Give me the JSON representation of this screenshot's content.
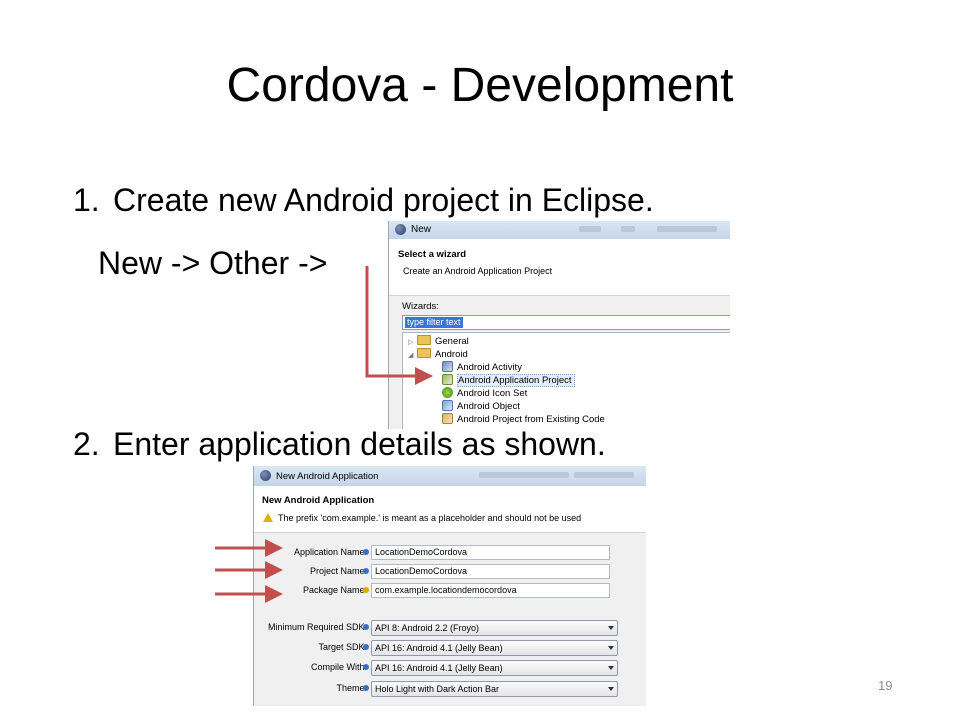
{
  "slide": {
    "title": "Cordova - Development",
    "step1_number": "1.",
    "step1_text": "Create new Android project in Eclipse.",
    "path_text": "New -> Other ->",
    "step2_number": "2.",
    "step2_text": "Enter application details as shown.",
    "slide_number": "19"
  },
  "wizard_dialog": {
    "title": "New",
    "header_title": "Select a wizard",
    "header_subtitle": "Create an Android Application Project",
    "wizards_label": "Wizards:",
    "filter_text": "type filter text",
    "tree": [
      {
        "label": "General",
        "icon": "folder-icon",
        "expanded": false
      },
      {
        "label": "Android",
        "icon": "folder-icon",
        "expanded": true
      },
      {
        "label": "Android Activity",
        "icon": "android-activity-icon"
      },
      {
        "label": "Android Application Project",
        "icon": "android-project-icon",
        "selected": true
      },
      {
        "label": "Android Icon Set",
        "icon": "android-icon-set-icon"
      },
      {
        "label": "Android Object",
        "icon": "android-object-icon"
      },
      {
        "label": "Android Project from Existing Code",
        "icon": "android-existing-code-icon"
      }
    ]
  },
  "app_dialog": {
    "title": "New Android Application",
    "header_title": "New Android Application",
    "warning_text": "The prefix 'com.example.' is meant as a placeholder and should not be used",
    "fields": [
      {
        "label": "Application Name:",
        "value": "LocationDemoCordova"
      },
      {
        "label": "Project Name:",
        "value": "LocationDemoCordova"
      },
      {
        "label": "Package Name:",
        "value": "com.example.locationdemocordova"
      }
    ],
    "selects": [
      {
        "label": "Minimum Required SDK:",
        "value": "API 8: Android 2.2 (Froyo)"
      },
      {
        "label": "Target SDK:",
        "value": "API 16: Android 4.1 (Jelly Bean)"
      },
      {
        "label": "Compile With:",
        "value": "API 16: Android 4.1 (Jelly Bean)"
      },
      {
        "label": "Theme:",
        "value": "Holo Light with Dark Action Bar"
      }
    ]
  },
  "colors": {
    "annotation_arrow": "#c0504d",
    "selection": "#3875d7"
  }
}
